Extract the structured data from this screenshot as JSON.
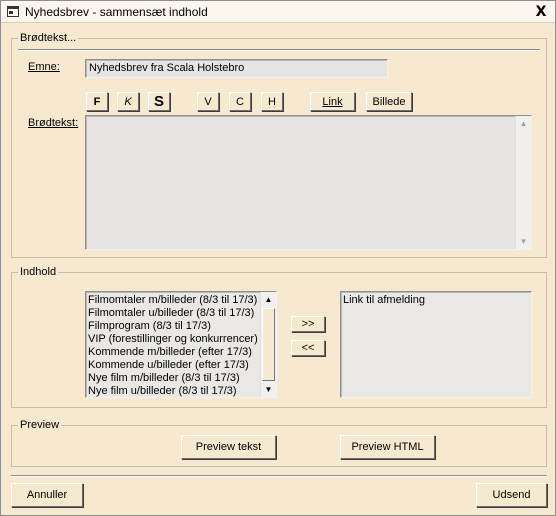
{
  "window": {
    "title": "Nyhedsbrev - sammensæt indhold",
    "close_glyph": "X"
  },
  "brodtekst_group": {
    "legend": "Brødtekst...",
    "emne_label": "Emne:",
    "emne_value": "Nyhedsbrev fra Scala Holstebro",
    "body_label": "Brødtekst:",
    "body_value": "",
    "format_buttons": {
      "bold": "F",
      "italic": "K",
      "large": "S",
      "left": "V",
      "center": "C",
      "right": "H",
      "link": "Link",
      "image": "Billede"
    }
  },
  "indhold_group": {
    "legend": "Indhold",
    "available_items": [
      "Filmomtaler m/billeder (8/3 til 17/3)",
      "Filmomtaler u/billeder (8/3 til 17/3)",
      "Filmprogram (8/3 til 17/3)",
      "VIP (forestillinger og konkurrencer)",
      "Kommende m/billeder (efter 17/3)",
      "Kommende u/billeder (efter 17/3)",
      "Nye film m/billeder (8/3 til 17/3)",
      "Nye film u/billeder (8/3 til 17/3)"
    ],
    "selected_items": [
      "Link til afmelding"
    ],
    "add_button": ">>",
    "remove_button": "<<"
  },
  "preview_group": {
    "legend": "Preview",
    "text_button": "Preview tekst",
    "html_button": "Preview HTML"
  },
  "footer": {
    "cancel_button": "Annuller",
    "send_button": "Udsend"
  }
}
